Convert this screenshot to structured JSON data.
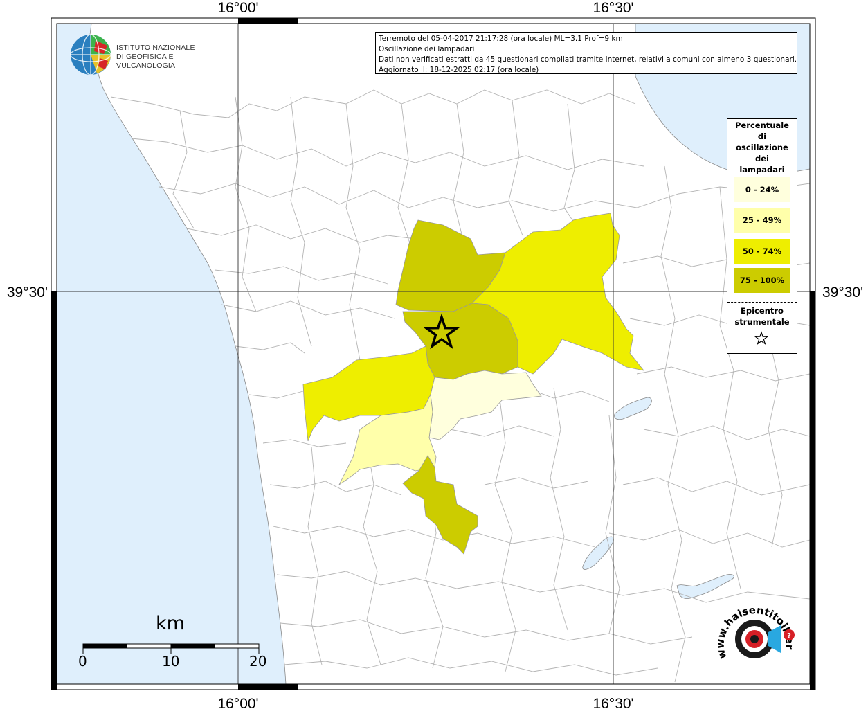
{
  "map": {
    "coordinates": {
      "lon_left": "16°00'",
      "lon_right": "16°30'",
      "lat": "39°30'"
    }
  },
  "info": {
    "line1": "Terremoto del 05-04-2017 21:17:28 (ora locale) ML=3.1 Prof=9 km",
    "line2": "Oscillazione dei lampadari",
    "line3": "Dati non verificati estratti da 45 questionari compilati tramite Internet, relativi a comuni con almeno 3 questionari.",
    "line4": "Aggiornato il: 18-12-2025 02:17 (ora locale)"
  },
  "legend": {
    "title_lines": [
      "Percentuale",
      "di",
      "oscillazione",
      "dei",
      "lampadari"
    ],
    "classes": [
      {
        "label": "0 - 24%",
        "color": "#ffffdd"
      },
      {
        "label": "25 - 49%",
        "color": "#ffffaa"
      },
      {
        "label": "50 - 74%",
        "color": "#eeee00"
      },
      {
        "label": "75 - 100%",
        "color": "#cccc00"
      }
    ],
    "epicenter_lines": [
      "Epicentro",
      "strumentale"
    ]
  },
  "logo": {
    "line1": "ISTITUTO NAZIONALE",
    "line2": "DI GEOFISICA E VULCANOLOGIA"
  },
  "scale": {
    "title": "km",
    "labels": [
      "0",
      "10",
      "20"
    ]
  },
  "badge": {
    "text": "www.haisentitoilterremoto.it"
  },
  "colors": {
    "sea": "#dfeffc",
    "land": "#ffffff",
    "boundaries": "#b4b4b4"
  }
}
